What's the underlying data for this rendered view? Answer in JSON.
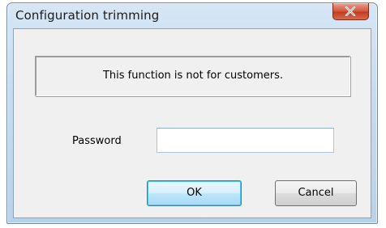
{
  "window": {
    "title": "Configuration trimming"
  },
  "notice": {
    "text": "This function is not for customers."
  },
  "password": {
    "label": "Password",
    "value": ""
  },
  "buttons": {
    "ok_label": "OK",
    "cancel_label": "Cancel"
  },
  "icons": {
    "close": "close-icon"
  },
  "colors": {
    "close_button": "#c9452a",
    "title_bar": "#c6dbf0",
    "client_bg": "#f0f0f0",
    "default_button_border": "#3c7fb1"
  }
}
